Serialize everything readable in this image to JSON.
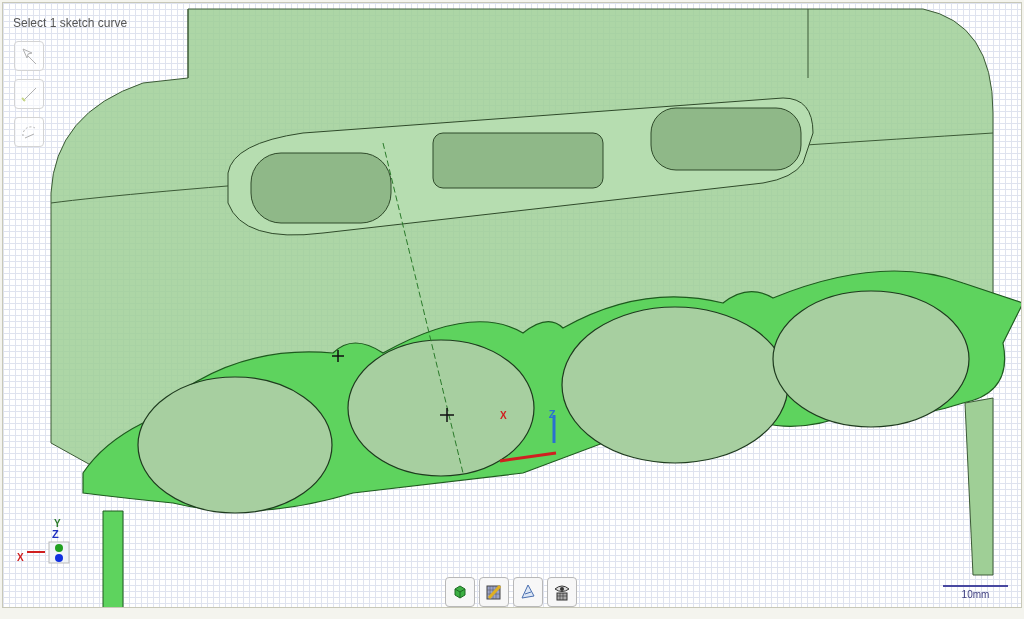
{
  "viewport": {
    "prompt": "Select 1 sketch curve",
    "scale_label": "10mm"
  },
  "side_tools": [
    {
      "kind": "select"
    },
    {
      "kind": "line"
    },
    {
      "kind": "arc"
    }
  ],
  "sketch_triad": {
    "x": "X",
    "z": "Z"
  },
  "view_gizmo": {
    "x": "X",
    "y": "Y",
    "z": "Z"
  },
  "bottom_toolbar": [
    {
      "kind": "solid"
    },
    {
      "kind": "sketch"
    },
    {
      "kind": "construct"
    },
    {
      "kind": "visibility"
    }
  ]
}
